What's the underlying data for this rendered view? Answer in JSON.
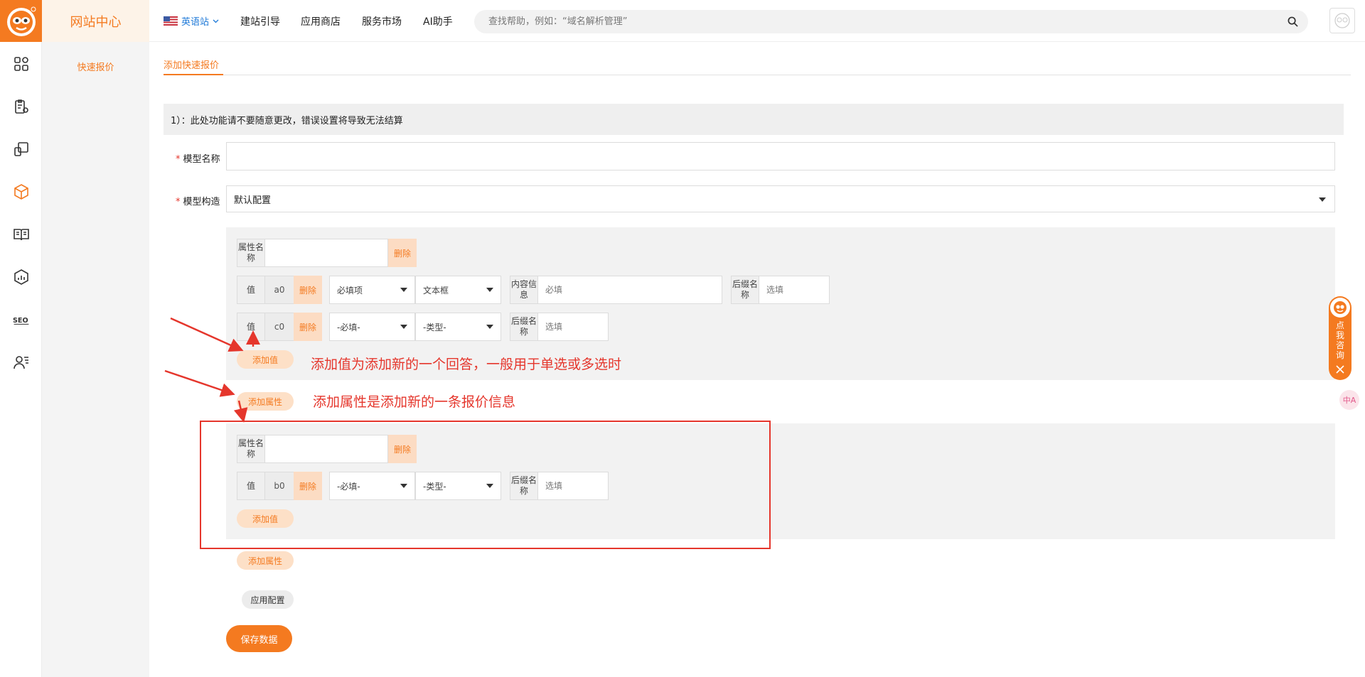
{
  "side": {
    "title": "网站中心",
    "item": "快速报价"
  },
  "topbar": {
    "lang": "英语站",
    "nav": [
      "建站引导",
      "应用商店",
      "服务市场",
      "AI助手"
    ],
    "search_placeholder": "查找帮助，例如：“域名解析管理”"
  },
  "tab": {
    "label": "添加快速报价"
  },
  "notice": "1）：此处功能请不要随意更改，错误设置将导致无法结算",
  "form": {
    "model_name_label": "模型名称",
    "model_struct_label": "模型构造",
    "model_struct_value": "默认配置",
    "required_mark": "*"
  },
  "group1": {
    "attr_label": "属性名称",
    "delete": "删除",
    "rows": [
      {
        "value_label": "值",
        "code": "a0",
        "delete": "删除",
        "required": "必填项",
        "type": "文本框",
        "content_label": "内容信息",
        "content_placeholder": "必填",
        "suffix_label": "后缀名称",
        "suffix_placeholder": "选填"
      },
      {
        "value_label": "值",
        "code": "c0",
        "delete": "删除",
        "required": "-必填-",
        "type": "-类型-",
        "suffix_label": "后缀名称",
        "suffix_placeholder": "选填"
      }
    ],
    "add_value": "添加值"
  },
  "add_attr_1": "添加属性",
  "group2": {
    "attr_label": "属性名称",
    "delete": "删除",
    "rows": [
      {
        "value_label": "值",
        "code": "b0",
        "delete": "删除",
        "required": "-必填-",
        "type": "-类型-",
        "suffix_label": "后缀名称",
        "suffix_placeholder": "选填"
      }
    ],
    "add_value": "添加值"
  },
  "add_attr_2": "添加属性",
  "apply_config": "应用配置",
  "save": "保存数据",
  "annotations": {
    "add_value_note": "添加值为添加新的一个回答，一般用于单选或多选时",
    "add_attr_note": "添加属性是添加新的一条报价信息"
  },
  "consult": {
    "label": "点我咨询"
  },
  "translate": {
    "label": "中A"
  },
  "colors": {
    "accent": "#f47a20",
    "annotation": "#e5362c"
  }
}
